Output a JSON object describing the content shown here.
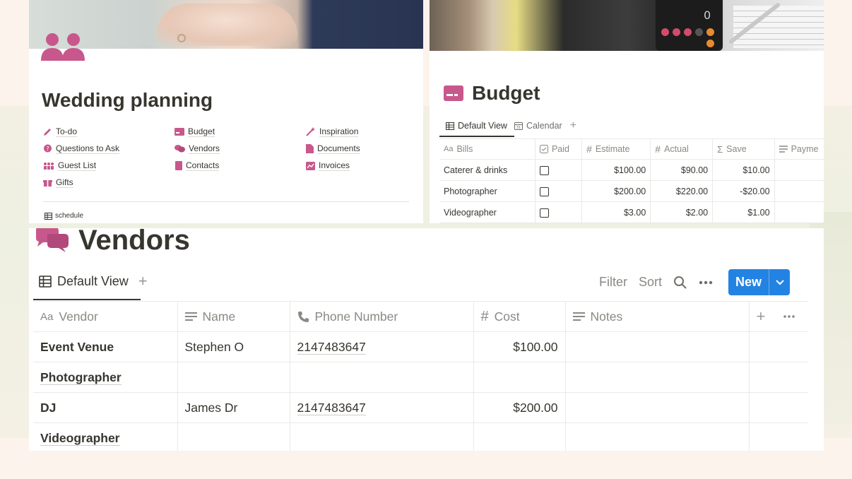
{
  "wedding_panel": {
    "title": "Wedding planning",
    "links": [
      {
        "label": "To-do",
        "icon": "pencil-icon"
      },
      {
        "label": "Questions to Ask",
        "icon": "question-bubble-icon"
      },
      {
        "label": "Guest List",
        "icon": "people-group-icon"
      },
      {
        "label": "Gifts",
        "icon": "gift-icon"
      },
      {
        "label": "Budget",
        "icon": "credit-card-icon"
      },
      {
        "label": "Vendors",
        "icon": "speech-bubbles-icon"
      },
      {
        "label": "Contacts",
        "icon": "phone-book-icon"
      },
      {
        "label": "Inspiration",
        "icon": "magic-wand-icon"
      },
      {
        "label": "Documents",
        "icon": "document-icon"
      },
      {
        "label": "Invoices",
        "icon": "chart-icon"
      }
    ],
    "schedule_label": "schedule"
  },
  "budget_panel": {
    "title": "Budget",
    "tabs": [
      "Default View",
      "Calendar"
    ],
    "columns": [
      "Bills",
      "Paid",
      "Estimate",
      "Actual",
      "Save",
      "Payme"
    ],
    "rows": [
      {
        "bill": "Caterer & drinks",
        "estimate": "$100.00",
        "actual": "$90.00",
        "save": "$10.00"
      },
      {
        "bill": "Photographer",
        "estimate": "$200.00",
        "actual": "$220.00",
        "save": "-$20.00"
      },
      {
        "bill": "Videographer",
        "estimate": "$3.00",
        "actual": "$2.00",
        "save": "$1.00"
      }
    ]
  },
  "vendors_panel": {
    "title": "Vendors",
    "tab": "Default View",
    "toolbar": {
      "filter": "Filter",
      "sort": "Sort",
      "new": "New"
    },
    "columns": [
      "Vendor",
      "Name",
      "Phone Number",
      "Cost",
      "Notes"
    ],
    "rows": [
      {
        "vendor": "Event Venue",
        "name": "Stephen O",
        "phone": "2147483647",
        "cost": "$100.00",
        "notes": ""
      },
      {
        "vendor": "Photographer",
        "name": "",
        "phone": "",
        "cost": "",
        "notes": ""
      },
      {
        "vendor": "DJ",
        "name": "James Dr",
        "phone": "2147483647",
        "cost": "$200.00",
        "notes": ""
      },
      {
        "vendor": "Videographer",
        "name": "",
        "phone": "",
        "cost": "",
        "notes": ""
      }
    ]
  },
  "colors": {
    "accent_pink": "#c8588c",
    "button_blue": "#2383e2",
    "text": "#37352f"
  }
}
